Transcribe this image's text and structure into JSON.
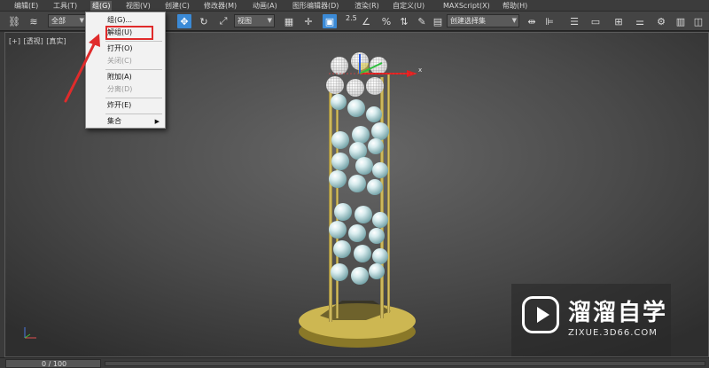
{
  "menubar": {
    "items": [
      {
        "label": "编辑(E)"
      },
      {
        "label": "工具(T)"
      },
      {
        "label": "组(G)"
      },
      {
        "label": "视图(V)"
      },
      {
        "label": "创建(C)"
      },
      {
        "label": "修改器(M)"
      },
      {
        "label": "动画(A)"
      },
      {
        "label": "图形编辑器(D)"
      },
      {
        "label": "渲染(R)"
      },
      {
        "label": "自定义(U)"
      },
      {
        "label": "MAXScript(X)"
      },
      {
        "label": "帮助(H)"
      }
    ]
  },
  "toolbar": {
    "selection_filter": "全部",
    "reference_coord": "视图",
    "angle_snap": "2.5",
    "named_selection_placeholder": "创建选择集"
  },
  "group_menu": {
    "items": [
      {
        "label": "组(G)...",
        "enabled": true
      },
      {
        "label": "解组(U)",
        "enabled": true,
        "highlighted": true
      },
      {
        "label": "打开(O)",
        "enabled": true
      },
      {
        "label": "关闭(C)",
        "enabled": false
      },
      {
        "label": "附加(A)",
        "enabled": true
      },
      {
        "label": "分离(D)",
        "enabled": false
      },
      {
        "label": "炸开(E)",
        "enabled": true
      },
      {
        "label": "集合",
        "enabled": true,
        "has_submenu": true
      }
    ]
  },
  "viewport": {
    "label_parts": [
      "[+]",
      "[透视]",
      "[真实]"
    ]
  },
  "watermark": {
    "title": "溜溜自学",
    "url": "ZIXUE.3D66.COM"
  },
  "timeline": {
    "frame_text": "0 / 100"
  },
  "colors": {
    "highlight_outline": "#e02b2b",
    "selected_tool": "#3b8ad6",
    "base_gold": "#c8b14a",
    "ball_blue": "#bcd9dc"
  }
}
